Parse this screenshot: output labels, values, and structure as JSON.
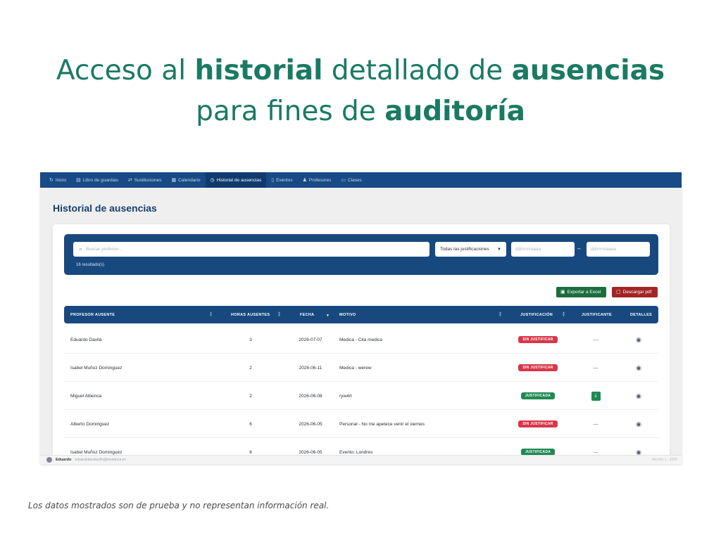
{
  "headline": {
    "line1_a": "Acceso al ",
    "line1_b": "historial",
    "line1_c": " detallado de ",
    "line1_d": "ausencias",
    "line2_a": "para fines de ",
    "line2_b": "auditoría"
  },
  "nav": {
    "items": [
      {
        "label": "Inicio",
        "icon": "refresh-icon"
      },
      {
        "label": "Libro de guardias",
        "icon": "book-icon"
      },
      {
        "label": "Sustituciones",
        "icon": "swap-icon"
      },
      {
        "label": "Calendario",
        "icon": "calendar-icon"
      },
      {
        "label": "Historial de ausencias",
        "icon": "clock-icon",
        "active": true
      },
      {
        "label": "Eventos",
        "icon": "document-icon"
      },
      {
        "label": "Profesores",
        "icon": "users-icon"
      },
      {
        "label": "Clases",
        "icon": "book-open-icon"
      }
    ]
  },
  "page": {
    "title": "Historial de ausencias"
  },
  "filters": {
    "search_placeholder": "Buscar profesor...",
    "justification_select": "Todas las justificaciones",
    "date_from_placeholder": "dd/mm/aaaa",
    "date_to_placeholder": "dd/mm/aaaa",
    "date_separator": "–",
    "results_count": "16 resultado(s)"
  },
  "actions": {
    "export_excel": "Exportar a Excel",
    "download_pdf": "Descargar pdf"
  },
  "table": {
    "headers": {
      "profesor": "PROFESOR AUSENTE",
      "horas": "HORAS AUSENTES",
      "fecha": "FECHA",
      "motivo": "MOTIVO",
      "justificacion": "JUSTIFICACIÓN",
      "justificante": "JUSTIFICANTE",
      "detalles": "DETALLES"
    },
    "rows": [
      {
        "profesor": "Eduardo Davilá",
        "horas": "3",
        "fecha": "2026-07-07",
        "motivo": "Medica - Cita medica",
        "justificacion": "SIN JUSTIFICAR",
        "justificado": false,
        "justificante": "—"
      },
      {
        "profesor": "Isabel Muñoz Dominguez",
        "horas": "2",
        "fecha": "2026-06-11",
        "motivo": "Medica - werew",
        "justificacion": "SIN JUSTIFICAR",
        "justificado": false,
        "justificante": "—"
      },
      {
        "profesor": "Miguel Albenca",
        "horas": "2",
        "fecha": "2026-06-08",
        "motivo": "ryw4rt",
        "justificacion": "JUSTIFICADA",
        "justificado": true,
        "justificante": ""
      },
      {
        "profesor": "Alberto Dominguez",
        "horas": "6",
        "fecha": "2026-06-05",
        "motivo": "Personal - No me apetece venir el viernes",
        "justificacion": "SIN JUSTIFICAR",
        "justificado": false,
        "justificante": "—"
      },
      {
        "profesor": "Isabel Muñoz Dominguez",
        "horas": "6",
        "fecha": "2026-06-05",
        "motivo": "Evento: Londres",
        "justificacion": "JUSTIFICADA",
        "justificado": true,
        "justificante": "—"
      }
    ]
  },
  "footer": {
    "user_name": "Eduardo",
    "user_email": "eduardodavilacdm@ieseduca.es",
    "version": "Versión 1 · 2026"
  },
  "disclaimer": "Los datos mostrados son de prueba y no representan información real.",
  "colors": {
    "brand_navy": "#17497f",
    "headline_green": "#1a7a63",
    "badge_unjustified": "#d9364a",
    "badge_justified": "#1e8a52",
    "excel_green": "#1c6d3e",
    "pdf_red": "#a32424"
  }
}
